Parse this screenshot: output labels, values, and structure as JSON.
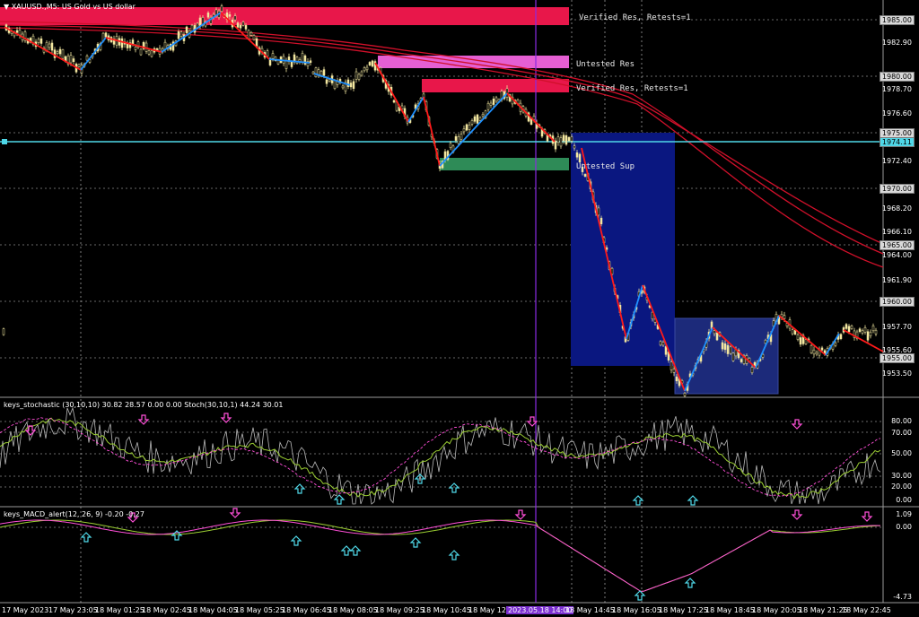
{
  "header": {
    "symbol_title": "XAUUSD.,M5: US Gold vs US dollar"
  },
  "price_axis": {
    "labels": [
      "1985.00",
      "1982.90",
      "1980.00",
      "1978.70",
      "1976.60",
      "1974.11",
      "1972.40",
      "1970.00",
      "1968.20",
      "1966.10",
      "1965.00",
      "1964.00",
      "1961.90",
      "1960.00",
      "1957.70",
      "1955.60",
      "1955.00",
      "1953.50"
    ],
    "current_price": "1974.11",
    "boxed_labels": [
      "1985.00",
      "1980.00",
      "1975.00",
      "1970.00",
      "1965.00",
      "1960.00",
      "1955.00"
    ]
  },
  "zones": {
    "verified_res_1": "Verified Res, Retests=1",
    "untested_res": "Untested Res",
    "verified_res_2": "Verified Res, Retests=1",
    "untested_sup": "Untested Sup",
    "colors": {
      "verified_res": "#e8174a",
      "untested_res": "#e55fd3",
      "untested_sup": "#2e8b57",
      "box_blue": "#0a1780",
      "box_slate": "#1c2a7a",
      "current_price_line": "#4fd8e8",
      "ma_lines": "#d0102a",
      "zigzag_down": "#ff1a1a",
      "zigzag_up": "#1e90ff",
      "candles": "#f2e6a0"
    }
  },
  "stochastic_panel": {
    "title": "keys_stochastic (30,10,10) 30.82 28.57 0.00 0.00 Stoch(30,10,1) 44.24 30.01",
    "levels": [
      "100.00",
      "80.00",
      "70.00",
      "50.00",
      "30.00",
      "20.00",
      "0.00"
    ]
  },
  "macd_panel": {
    "title": "keys_MACD_alert(12, 26, 9) -0.20 -0.27",
    "levels": [
      "1.09",
      "0.00",
      "-4.73"
    ]
  },
  "time_axis": {
    "labels": [
      "17 May 2023",
      "17 May 23:05",
      "18 May 01:25",
      "18 May 02:45",
      "18 May 04:05",
      "18 May 05:25",
      "18 May 06:45",
      "18 May 08:05",
      "18 May 09:25",
      "18 May 10:45",
      "18 May 12:05",
      "2023.05.18 14:00",
      "18 May 14:45",
      "18 May 16:05",
      "18 May 17:25",
      "18 May 18:45",
      "18 May 20:05",
      "18 May 21:25",
      "18 May 22:45"
    ],
    "highlighted": "2023.05.18 14:00"
  }
}
